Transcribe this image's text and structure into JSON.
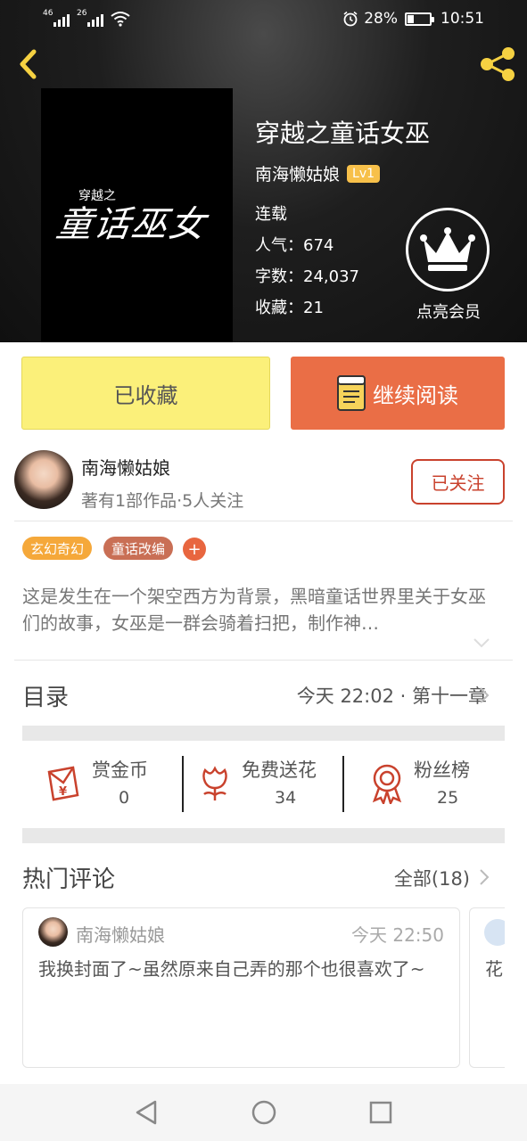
{
  "status_bar": {
    "signal1_label": "46",
    "signal2_label": "26",
    "battery_percent": "28%",
    "battery_level": 0.28,
    "time": "10:51"
  },
  "book": {
    "cover_text": "穿越之童话巫女",
    "cover_small_text": "穿越之",
    "cover_main_text": "童话巫女",
    "title": "穿越之童话女巫",
    "author": "南海懒姑娘",
    "level": "Lv1",
    "status": "连载",
    "popularity": "人气：674",
    "word_count": "字数：24,037",
    "favorites": "收藏：21",
    "vip_label": "点亮会员"
  },
  "actions": {
    "favorited_label": "已收藏",
    "continue_label": "继续阅读"
  },
  "author_card": {
    "name": "南海懒姑娘",
    "summary": "著有1部作品·5人关注",
    "follow_label": "已关注"
  },
  "tags": [
    {
      "label": "玄幻奇幻",
      "color": "#f5a83a"
    },
    {
      "label": "童话改编",
      "color": "#c96f55"
    }
  ],
  "tag_add": "+",
  "description": "这是发生在一个架空西方为背景，黑暗童话世界里关于女巫们的故事，女巫是一群会骑着扫把，制作神…",
  "toc": {
    "label": "目录",
    "latest": "今天 22:02 · 第十一章"
  },
  "stats": [
    {
      "label": "赏金币",
      "value": "0",
      "icon": "red-envelope-yen-icon"
    },
    {
      "label": "免费送花",
      "value": "34",
      "icon": "flower-icon"
    },
    {
      "label": "粉丝榜",
      "value": "25",
      "icon": "medal-icon"
    }
  ],
  "comments_section": {
    "label": "热门评论",
    "all_label": "全部(18)"
  },
  "comments": [
    {
      "user": "南海懒姑娘",
      "time": "今天 22:50",
      "text": "我换封面了~虽然原来自己弄的那个也很喜欢了~"
    },
    {
      "text": "花"
    }
  ],
  "colors": {
    "accent_orange": "#ea6e46",
    "favorite_yellow": "#fbf07a",
    "follow_red": "#c9422d",
    "gold": "#f5d142"
  }
}
